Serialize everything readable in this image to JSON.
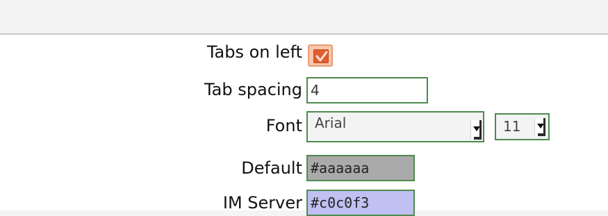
{
  "settings": {
    "tabs_on_left": {
      "label": "Tabs on left",
      "checked": true
    },
    "tab_spacing": {
      "label": "Tab spacing",
      "value": "4"
    },
    "font": {
      "label": "Font",
      "family_value": "Arial",
      "size_value": "11"
    },
    "default_color": {
      "label": "Default",
      "value": "#aaaaaa"
    },
    "im_server_color": {
      "label": "IM Server",
      "value": "#c0c0f3"
    }
  },
  "colors": {
    "checkbox_accent": "#e05f2e",
    "field_border": "#4e8a4e",
    "default_swatch": "#aaaaaa",
    "im_server_swatch": "#c0c0f3"
  },
  "icons": {
    "checkbox": "checkmark-icon",
    "dropdown": "dropdown-arrow-icon"
  }
}
